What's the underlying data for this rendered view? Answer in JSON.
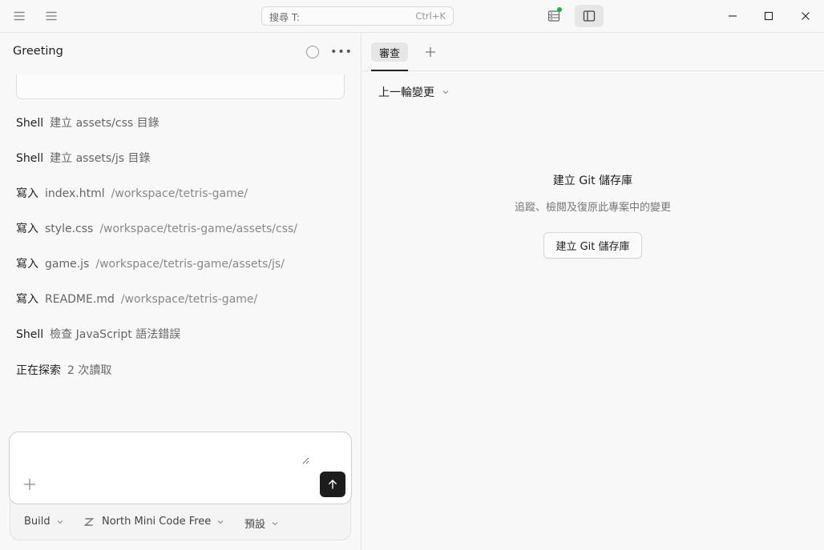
{
  "titlebar": {
    "search": {
      "placeholder": "搜尋 T:",
      "shortcut": "Ctrl+K"
    }
  },
  "session": {
    "title": "Greeting",
    "logs": [
      {
        "kind": "Shell",
        "arg": "建立 assets/css 目錄",
        "path": ""
      },
      {
        "kind": "Shell",
        "arg": "建立 assets/js 目錄",
        "path": ""
      },
      {
        "kind": "寫入",
        "arg": "index.html",
        "path": "/workspace/tetris-game/"
      },
      {
        "kind": "寫入",
        "arg": "style.css",
        "path": "/workspace/tetris-game/assets/css/"
      },
      {
        "kind": "寫入",
        "arg": "game.js",
        "path": "/workspace/tetris-game/assets/js/"
      },
      {
        "kind": "寫入",
        "arg": "README.md",
        "path": "/workspace/tetris-game/"
      },
      {
        "kind": "Shell",
        "arg": "檢查 JavaScript 語法錯誤",
        "path": ""
      },
      {
        "kind": "正在探索",
        "arg": "2 次讀取",
        "path": ""
      }
    ]
  },
  "composer": {
    "value": "",
    "mode": "Build",
    "model": "North Mini Code Free",
    "variant": "預設"
  },
  "review": {
    "tab_label": "審查",
    "changes_label": "上一輪變更",
    "empty_title": "建立 Git 儲存庫",
    "empty_desc": "追蹤、檢閱及復原此專案中的變更",
    "create_button": "建立 Git 儲存庫"
  },
  "colors": {
    "status_dot": "#1fb33c",
    "send_button": "#1c1c1c"
  }
}
